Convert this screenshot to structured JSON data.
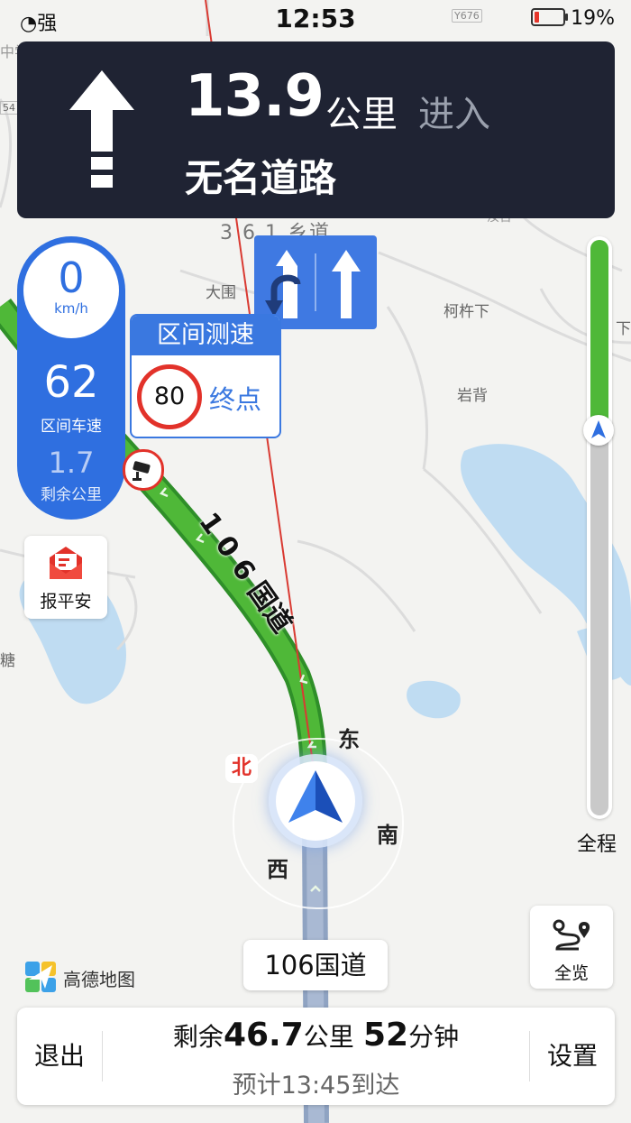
{
  "status_bar": {
    "signal_label": "强",
    "time": "12:53",
    "battery_percent": "19%",
    "battery_level": 0.19
  },
  "nav_banner": {
    "distance_value": "13.9",
    "distance_unit": "公里",
    "action": "进入",
    "road_name": "无名道路"
  },
  "speed_panel": {
    "current_speed": "0",
    "speed_unit": "km/h",
    "average_speed": "62",
    "average_speed_label": "区间车速",
    "remaining_distance": "1.7",
    "remaining_label": "剩余公里"
  },
  "zone_card": {
    "title": "区间测速",
    "speed_limit": "80",
    "end_label": "终点"
  },
  "safety_button": {
    "label": "报平安"
  },
  "map": {
    "road_shield_label": "106国道",
    "route_label": "1 0 6 国道",
    "place_labels": [
      "大围",
      "柯杵下",
      "岩背",
      "下",
      "糖",
      "Y676",
      "中学",
      "54",
      "3 6 1 乡道",
      "汝台"
    ],
    "compass": {
      "north": "北",
      "east": "东",
      "south": "南",
      "west": "西"
    },
    "colors": {
      "route_green": "#4fb838",
      "route_passed": "#8fa3c2",
      "bearing_line": "#d93a32",
      "water": "#bfdcf2"
    }
  },
  "progress": {
    "label": "全程",
    "fraction_remaining": 0.33
  },
  "overview_button": {
    "label": "全览"
  },
  "logo": {
    "text": "高德地图"
  },
  "bottom_bar": {
    "exit_label": "退出",
    "remain_prefix": "剩余",
    "remain_distance": "46.7",
    "remain_distance_unit": "公里",
    "remain_time": "52",
    "remain_time_unit": "分钟",
    "eta_text": "预计13:45到达",
    "settings_label": "设置"
  }
}
